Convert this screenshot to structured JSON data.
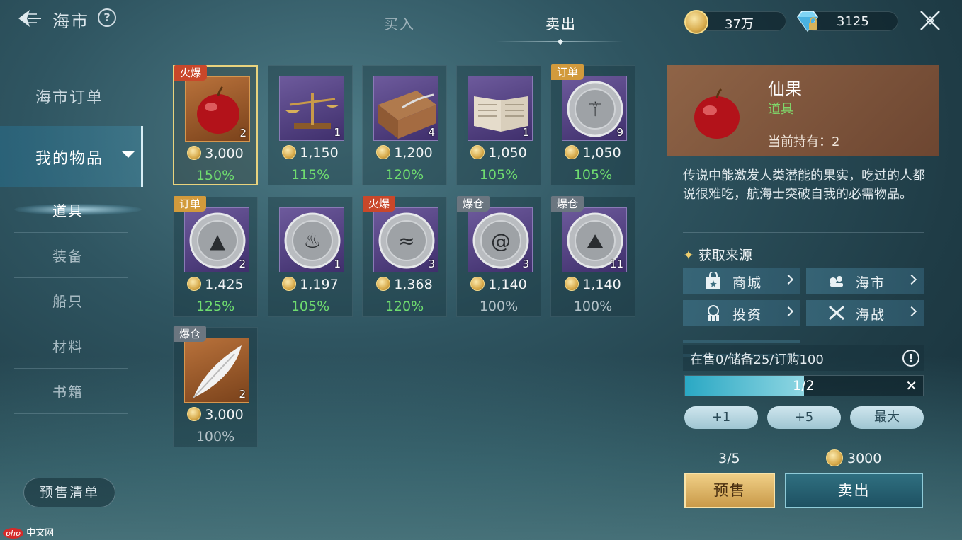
{
  "header": {
    "title": "海市",
    "help": "?",
    "tabs": [
      {
        "label": "买入"
      },
      {
        "label": "卖出"
      }
    ],
    "gold": "37万",
    "gems": "3125"
  },
  "sidebar": {
    "order": "海市订单",
    "mine": "我的物品",
    "subs": [
      "道具",
      "装备",
      "船只",
      "材料",
      "书籍"
    ],
    "presale_list": "预售清单"
  },
  "items": [
    {
      "tag": "火爆",
      "tag_type": "hot",
      "qty": "2",
      "price": "3,000",
      "pct": "150%",
      "trend": "up",
      "icon": "apple-icon",
      "bg": "orange"
    },
    {
      "tag": "",
      "tag_type": "",
      "qty": "1",
      "price": "1,150",
      "pct": "115%",
      "trend": "up",
      "icon": "scale-icon",
      "bg": "purple"
    },
    {
      "tag": "",
      "tag_type": "",
      "qty": "4",
      "price": "1,200",
      "pct": "120%",
      "trend": "up",
      "icon": "box-quill-icon",
      "bg": "purple"
    },
    {
      "tag": "",
      "tag_type": "",
      "qty": "1",
      "price": "1,050",
      "pct": "105%",
      "trend": "up",
      "icon": "book-icon",
      "bg": "purple"
    },
    {
      "tag": "订单",
      "tag_type": "order",
      "qty": "9",
      "price": "1,050",
      "pct": "105%",
      "trend": "up",
      "icon": "silver-coin-staff-icon",
      "bg": "purple"
    },
    {
      "tag": "订单",
      "tag_type": "order",
      "qty": "2",
      "price": "1,425",
      "pct": "125%",
      "trend": "up",
      "icon": "silver-coin-mountain-icon",
      "bg": "purple"
    },
    {
      "tag": "",
      "tag_type": "",
      "qty": "1",
      "price": "1,197",
      "pct": "105%",
      "trend": "up",
      "icon": "silver-coin-fire-icon",
      "bg": "purple"
    },
    {
      "tag": "火爆",
      "tag_type": "hot",
      "qty": "3",
      "price": "1,368",
      "pct": "120%",
      "trend": "up",
      "icon": "silver-coin-wave-icon",
      "bg": "purple"
    },
    {
      "tag": "爆仓",
      "tag_type": "burst",
      "qty": "3",
      "price": "1,140",
      "pct": "100%",
      "trend": "flat",
      "icon": "silver-coin-tornado-icon",
      "bg": "purple"
    },
    {
      "tag": "爆仓",
      "tag_type": "burst",
      "qty": "11",
      "price": "1,140",
      "pct": "100%",
      "trend": "flat",
      "icon": "silver-coin-rock-icon",
      "bg": "purple"
    },
    {
      "tag": "爆仓",
      "tag_type": "burst",
      "qty": "2",
      "price": "3,000",
      "pct": "100%",
      "trend": "flat",
      "icon": "feather-icon",
      "bg": "orange"
    }
  ],
  "detail": {
    "name": "仙果",
    "type": "道具",
    "hold": "当前持有：2",
    "desc": "传说中能激发人类潜能的果实，吃过的人都说很难吃，航海士突破自我的必需物品。",
    "source_title": "获取来源",
    "sources": [
      "商城",
      "海市",
      "投资",
      "海战"
    ],
    "stock": "在售0/储备25/订购100",
    "progress_text": "1/2",
    "progress_fraction": 0.5,
    "steps": [
      "+1",
      "+5",
      "最大"
    ],
    "count": "3/5",
    "sell_price": "3000",
    "presale_btn": "预售",
    "sell_btn": "卖出"
  },
  "watermark": "中文网",
  "watermark_brand": "php"
}
